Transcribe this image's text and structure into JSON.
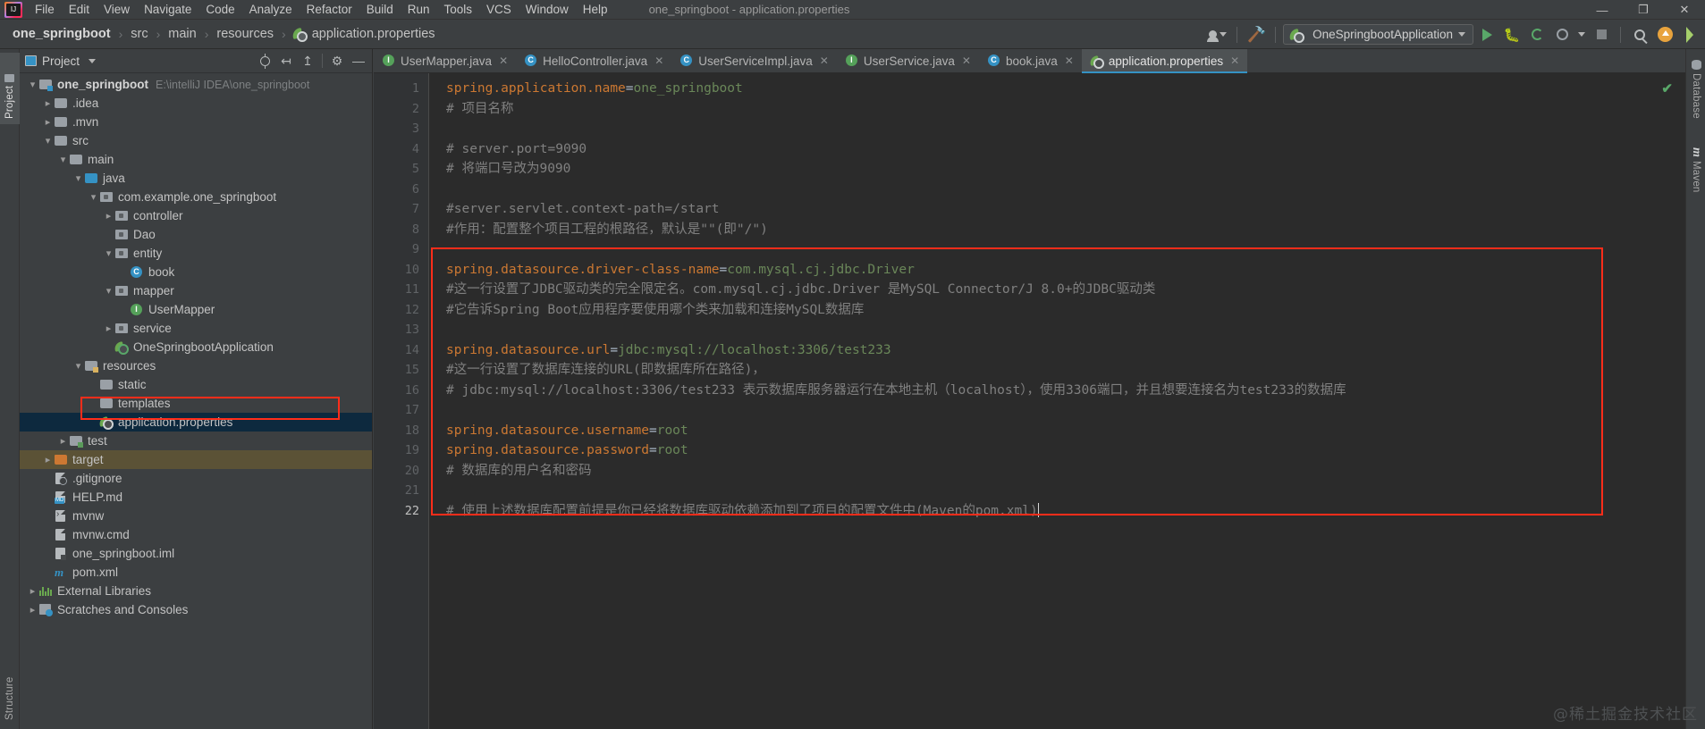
{
  "window": {
    "title": "one_springboot - application.properties",
    "controls": {
      "minimize": "—",
      "restore": "❐",
      "close": "✕"
    }
  },
  "menubar": {
    "items": [
      "File",
      "Edit",
      "View",
      "Navigate",
      "Code",
      "Analyze",
      "Refactor",
      "Build",
      "Run",
      "Tools",
      "VCS",
      "Window",
      "Help"
    ]
  },
  "breadcrumb": {
    "items": [
      "one_springboot",
      "src",
      "main",
      "resources",
      "application.properties"
    ],
    "separator": "›"
  },
  "toolbar": {
    "run_config": "OneSpringbootApplication",
    "buttons": [
      "settings-sync",
      "make-project",
      "run",
      "debug",
      "run-with-coverage",
      "profile",
      "stop",
      "search-everywhere",
      "update",
      "ide-helper"
    ]
  },
  "left_strip": {
    "tabs": [
      "Project",
      "Structure"
    ]
  },
  "right_strip": {
    "tabs": [
      "Database",
      "Maven"
    ]
  },
  "project_panel": {
    "title": "Project",
    "header_buttons": [
      "locate-icon",
      "expand-all-icon",
      "collapse-all-icon",
      "gear-icon",
      "hide-icon"
    ],
    "tree": [
      {
        "depth": 0,
        "arrow": "down",
        "icon": "module-folder",
        "label": "one_springboot",
        "bold": true,
        "path": "E:\\intelliJ IDEA\\one_springboot"
      },
      {
        "depth": 1,
        "arrow": "right",
        "icon": "folder",
        "label": ".idea"
      },
      {
        "depth": 1,
        "arrow": "right",
        "icon": "folder",
        "label": ".mvn"
      },
      {
        "depth": 1,
        "arrow": "down",
        "icon": "folder",
        "label": "src"
      },
      {
        "depth": 2,
        "arrow": "down",
        "icon": "folder",
        "label": "main"
      },
      {
        "depth": 3,
        "arrow": "down",
        "icon": "source-folder",
        "label": "java"
      },
      {
        "depth": 4,
        "arrow": "down",
        "icon": "package",
        "label": "com.example.one_springboot"
      },
      {
        "depth": 5,
        "arrow": "right",
        "icon": "package",
        "label": "controller"
      },
      {
        "depth": 5,
        "arrow": "none",
        "icon": "package",
        "label": "Dao"
      },
      {
        "depth": 5,
        "arrow": "down",
        "icon": "package",
        "label": "entity"
      },
      {
        "depth": 6,
        "arrow": "none",
        "icon": "class",
        "label": "book"
      },
      {
        "depth": 5,
        "arrow": "down",
        "icon": "package",
        "label": "mapper"
      },
      {
        "depth": 6,
        "arrow": "none",
        "icon": "interface",
        "label": "UserMapper"
      },
      {
        "depth": 5,
        "arrow": "right",
        "icon": "package",
        "label": "service"
      },
      {
        "depth": 5,
        "arrow": "none",
        "icon": "spring-boot-run",
        "label": "OneSpringbootApplication"
      },
      {
        "depth": 3,
        "arrow": "down",
        "icon": "resource-folder",
        "label": "resources"
      },
      {
        "depth": 4,
        "arrow": "none",
        "icon": "folder",
        "label": "static"
      },
      {
        "depth": 4,
        "arrow": "none",
        "icon": "folder",
        "label": "templates"
      },
      {
        "depth": 4,
        "arrow": "none",
        "icon": "spring-properties",
        "label": "application.properties",
        "selected": true,
        "highlighted": true
      },
      {
        "depth": 2,
        "arrow": "right",
        "icon": "test-folder",
        "label": "test"
      },
      {
        "depth": 1,
        "arrow": "right",
        "icon": "target-folder",
        "label": "target",
        "target": true
      },
      {
        "depth": 1,
        "arrow": "none",
        "icon": "gitignore-file",
        "label": ".gitignore"
      },
      {
        "depth": 1,
        "arrow": "none",
        "icon": "markdown-file",
        "label": "HELP.md"
      },
      {
        "depth": 1,
        "arrow": "none",
        "icon": "shell-file",
        "label": "mvnw"
      },
      {
        "depth": 1,
        "arrow": "none",
        "icon": "text-file",
        "label": "mvnw.cmd"
      },
      {
        "depth": 1,
        "arrow": "none",
        "icon": "iml-file",
        "label": "one_springboot.iml"
      },
      {
        "depth": 1,
        "arrow": "none",
        "icon": "maven-file",
        "label": "pom.xml"
      },
      {
        "depth": 0,
        "arrow": "right",
        "icon": "external-libraries",
        "label": "External Libraries"
      },
      {
        "depth": 0,
        "arrow": "right",
        "icon": "scratches",
        "label": "Scratches and Consoles"
      }
    ]
  },
  "editor": {
    "tabs": [
      {
        "label": "UserMapper.java",
        "icon": "interface",
        "active": false,
        "close": "✕"
      },
      {
        "label": "HelloController.java",
        "icon": "class",
        "active": false,
        "close": "✕"
      },
      {
        "label": "UserServiceImpl.java",
        "icon": "class",
        "active": false,
        "close": "✕"
      },
      {
        "label": "UserService.java",
        "icon": "interface",
        "active": false,
        "close": "✕"
      },
      {
        "label": "book.java",
        "icon": "class",
        "active": false,
        "close": "✕"
      },
      {
        "label": "application.properties",
        "icon": "spring",
        "active": true,
        "close": "✕"
      }
    ],
    "inspection_status": "✔",
    "lines": [
      {
        "n": 1,
        "segments": [
          {
            "t": "spring.application.name",
            "c": "key"
          },
          {
            "t": "=",
            "c": "eq"
          },
          {
            "t": "one_springboot",
            "c": "val"
          }
        ]
      },
      {
        "n": 2,
        "segments": [
          {
            "t": "# 项目名称",
            "c": "cmt"
          }
        ]
      },
      {
        "n": 3,
        "segments": []
      },
      {
        "n": 4,
        "segments": [
          {
            "t": "# server.port=9090",
            "c": "cmt"
          }
        ]
      },
      {
        "n": 5,
        "segments": [
          {
            "t": "# 将端口号改为9090",
            "c": "cmt"
          }
        ]
      },
      {
        "n": 6,
        "segments": []
      },
      {
        "n": 7,
        "segments": [
          {
            "t": "#server.servlet.context-path=/start",
            "c": "cmt"
          }
        ]
      },
      {
        "n": 8,
        "segments": [
          {
            "t": "#作用：配置整个项目工程的根路径，默认是\"\"(即\"/\")",
            "c": "cmt"
          }
        ]
      },
      {
        "n": 9,
        "segments": []
      },
      {
        "n": 10,
        "segments": [
          {
            "t": "spring.datasource.driver-class-name",
            "c": "key"
          },
          {
            "t": "=",
            "c": "eq"
          },
          {
            "t": "com.mysql.cj.jdbc.Driver",
            "c": "val"
          }
        ]
      },
      {
        "n": 11,
        "segments": [
          {
            "t": "#这一行设置了JDBC驱动类的完全限定名。com.mysql.cj.jdbc.Driver 是MySQL Connector/J 8.0+的JDBC驱动类",
            "c": "cmt"
          }
        ]
      },
      {
        "n": 12,
        "segments": [
          {
            "t": "#它告诉Spring Boot应用程序要使用哪个类来加载和连接MySQL数据库",
            "c": "cmt"
          }
        ]
      },
      {
        "n": 13,
        "segments": []
      },
      {
        "n": 14,
        "segments": [
          {
            "t": "spring.datasource.url",
            "c": "key"
          },
          {
            "t": "=",
            "c": "eq"
          },
          {
            "t": "jdbc:mysql://localhost:3306/test233",
            "c": "val"
          }
        ]
      },
      {
        "n": 15,
        "segments": [
          {
            "t": "#这一行设置了数据库连接的URL(即数据库所在路径)，",
            "c": "cmt"
          }
        ]
      },
      {
        "n": 16,
        "segments": [
          {
            "t": "# jdbc:mysql://localhost:3306/test233 表示数据库服务器运行在本地主机（localhost），使用3306端口，并且想要连接名为test233的数据库",
            "c": "cmt"
          }
        ]
      },
      {
        "n": 17,
        "segments": []
      },
      {
        "n": 18,
        "segments": [
          {
            "t": "spring.datasource.username",
            "c": "key"
          },
          {
            "t": "=",
            "c": "eq"
          },
          {
            "t": "root",
            "c": "val"
          }
        ]
      },
      {
        "n": 19,
        "segments": [
          {
            "t": "spring.datasource.password",
            "c": "key"
          },
          {
            "t": "=",
            "c": "eq"
          },
          {
            "t": "root",
            "c": "val"
          }
        ]
      },
      {
        "n": 20,
        "segments": [
          {
            "t": "# 数据库的用户名和密码",
            "c": "cmt"
          }
        ]
      },
      {
        "n": 21,
        "segments": []
      },
      {
        "n": 22,
        "segments": [
          {
            "t": "# 使用上述数据库配置前提是你已经将数据库驱动依赖添加到了项目的配置文件中(Maven的pom.xml)",
            "c": "cmt"
          }
        ],
        "current": true
      }
    ]
  },
  "watermark": "@稀土掘金技术社区",
  "colors": {
    "accent": "#3592c4",
    "key": "#cc7832",
    "value": "#6a8759",
    "comment": "#808080",
    "highlight_box": "#ff2d1a",
    "selection": "#0d293e",
    "editor_bg": "#2b2b2b",
    "panel_bg": "#3c3f41"
  }
}
